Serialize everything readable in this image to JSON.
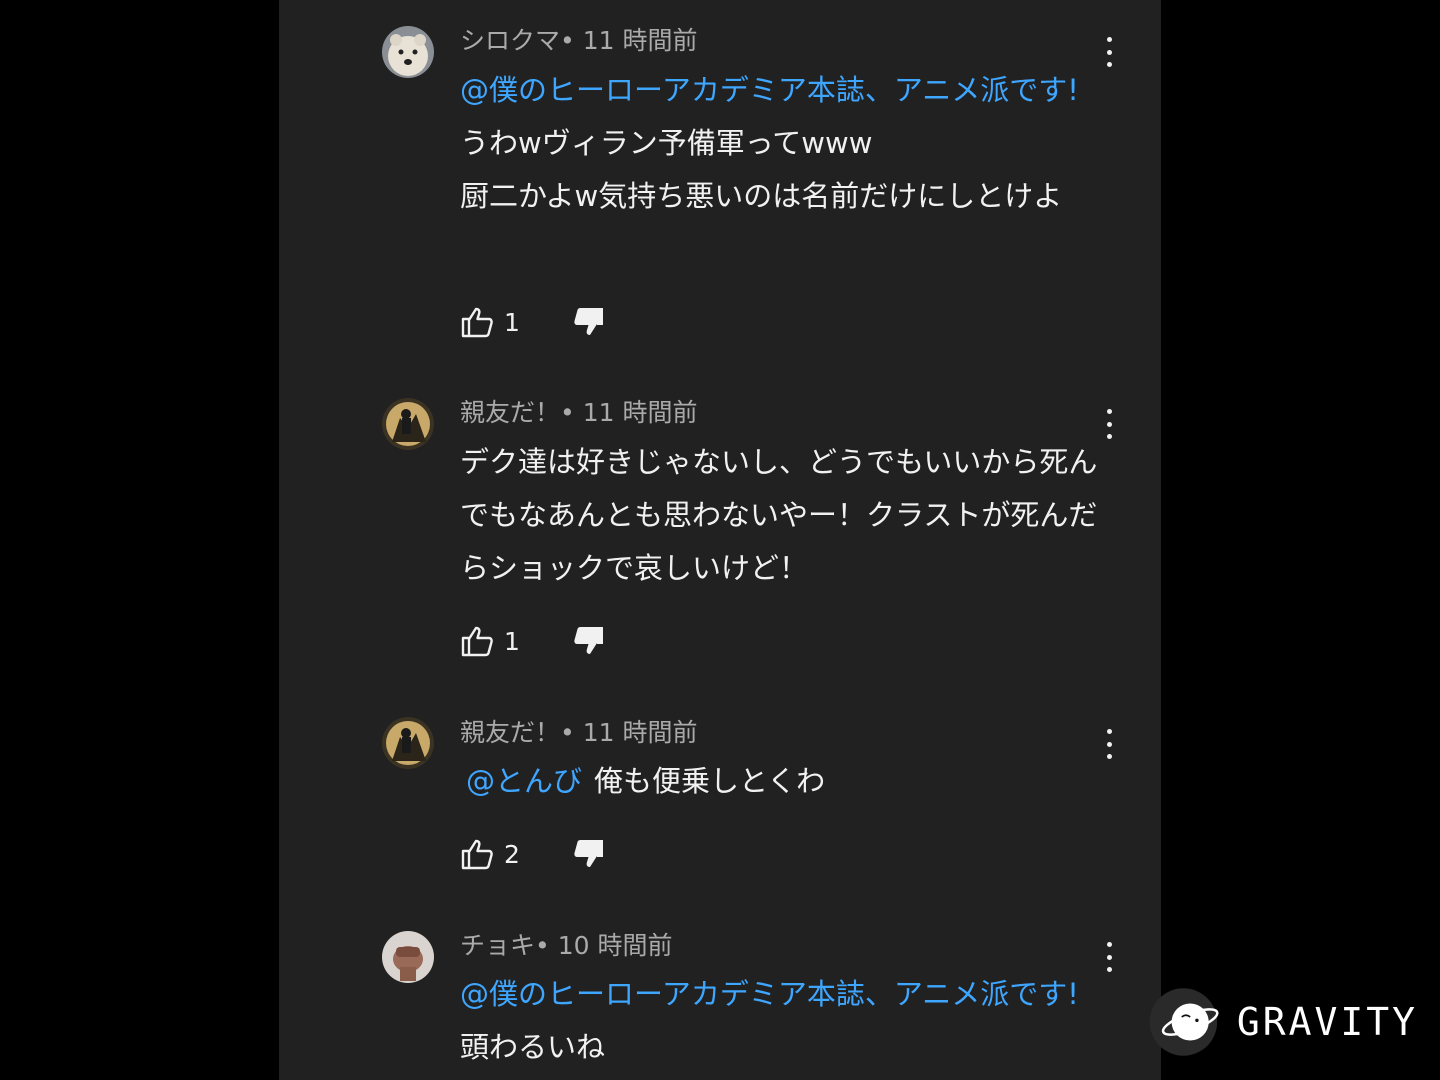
{
  "comments": [
    {
      "author": "シロクマ",
      "time": "• 11 時間前",
      "mention": "@僕のヒーローアカデミア本誌、アニメ派です!",
      "text_lines": [
        "うわwヴィラン予備軍ってwww",
        "厨二かよw気持ち悪いのは名前だけにしとけよ"
      ],
      "likes": "1",
      "avatar": "polar-bear-avatar"
    },
    {
      "author": "親友だ！",
      "time": "• 11 時間前",
      "text": "デク達は好きじゃないし、どうでもいいから死んでもなあんとも思わないやー！クラストが死んだらショックで哀しいけど！",
      "likes": "1",
      "avatar": "anime-character-avatar"
    },
    {
      "author": "親友だ！",
      "time": "• 11 時間前",
      "mention": "@とんび",
      "text": "俺も便乗しとくわ",
      "likes": "2",
      "avatar": "anime-character-avatar"
    },
    {
      "author": "チョキ",
      "time": "• 10 時間前",
      "mention": "@僕のヒーローアカデミア本誌、アニメ派です!",
      "text": "頭わるいね",
      "avatar": "fist-avatar"
    }
  ],
  "watermark": {
    "text": "GRAVITY"
  },
  "colors": {
    "background": "#212121",
    "mention": "#3ea6ff",
    "text": "#f1f1f1",
    "meta": "#aaaaaa"
  }
}
